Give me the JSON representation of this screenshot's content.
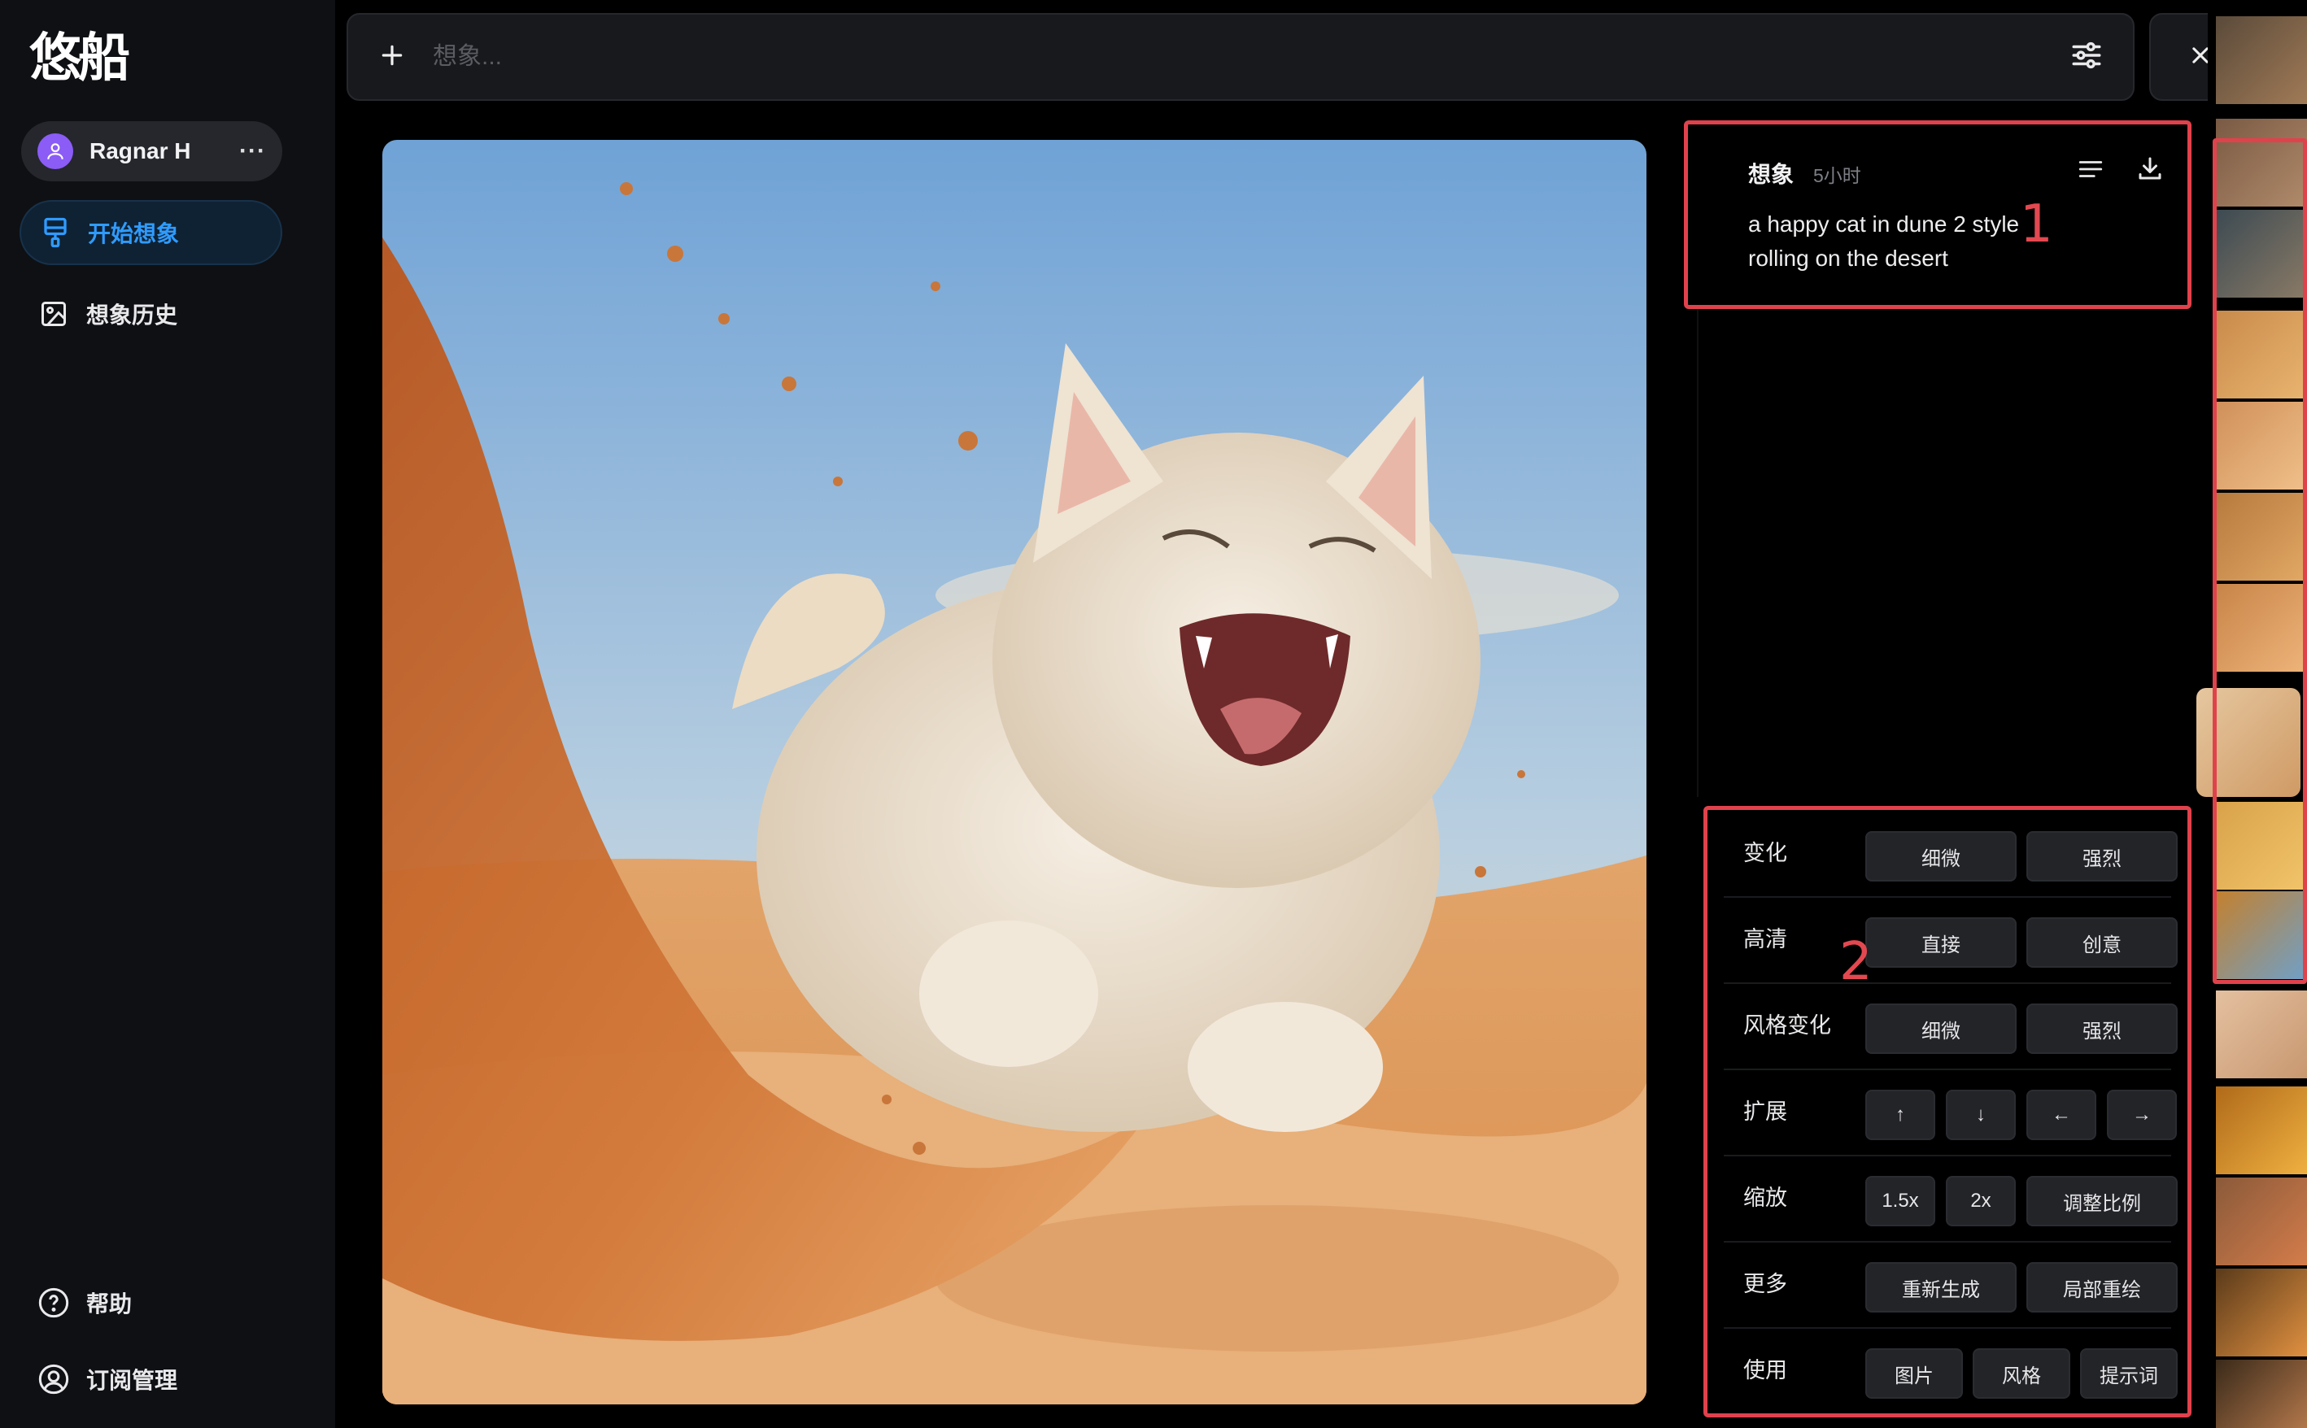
{
  "app": {
    "logo_text": "悠船"
  },
  "user": {
    "name": "Ragnar H",
    "more": "···"
  },
  "nav": {
    "start": "开始想象",
    "history": "想象历史",
    "help": "帮助",
    "subscription": "订阅管理"
  },
  "prompt_bar": {
    "placeholder": "想象..."
  },
  "info": {
    "title": "想象",
    "time": "5小时",
    "prompt": "a happy cat in dune 2 style rolling on the desert",
    "marker": "1"
  },
  "actions": {
    "marker": "2",
    "rows": [
      {
        "label": "变化",
        "buttons": [
          "细微",
          "强烈"
        ]
      },
      {
        "label": "高清",
        "buttons": [
          "直接",
          "创意"
        ]
      },
      {
        "label": "风格变化",
        "buttons": [
          "细微",
          "强烈"
        ]
      },
      {
        "label": "扩展",
        "buttons": [
          "↑",
          "↓",
          "←",
          "→"
        ]
      },
      {
        "label": "缩放",
        "buttons": [
          "1.5x",
          "2x",
          "调整比例"
        ]
      },
      {
        "label": "更多",
        "buttons": [
          "重新生成",
          "局部重绘"
        ]
      },
      {
        "label": "使用",
        "buttons": [
          "图片",
          "风格",
          "提示词"
        ]
      }
    ]
  },
  "colors": {
    "accent": "#2f9bff",
    "annotation": "#e0424c",
    "avatar": "#8b5cf6"
  }
}
